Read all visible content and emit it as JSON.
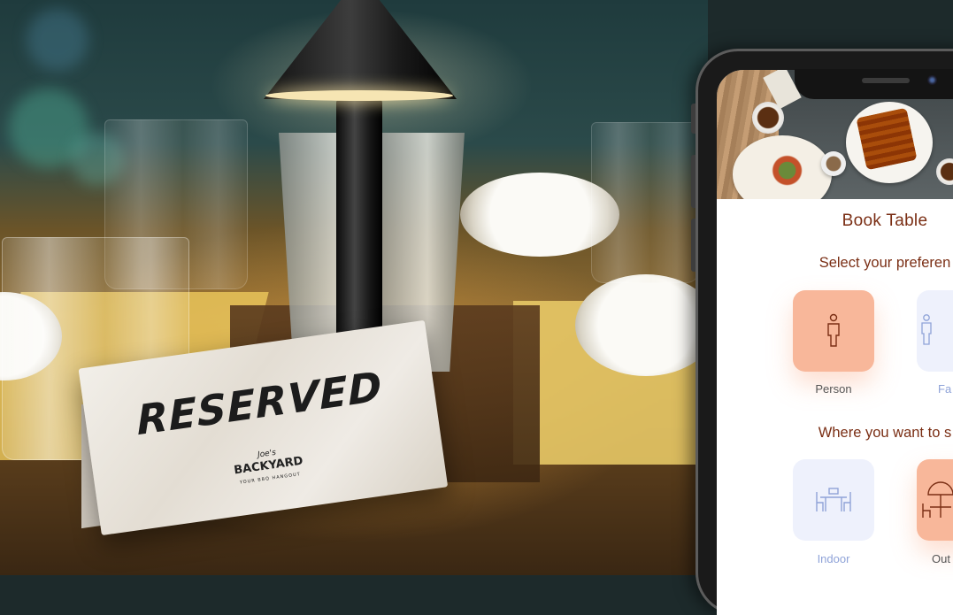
{
  "sign": {
    "title": "RESERVED",
    "brand_line1": "Joe's",
    "brand_line2": "BACKYARD",
    "brand_tagline": "YOUR BBQ HANGOUT"
  },
  "app": {
    "title": "Book Table",
    "preference_heading": "Select your preferen",
    "preference_options": [
      {
        "label": "Person",
        "icon": "person-icon",
        "state": "selected"
      },
      {
        "label": "Fa",
        "icon": "family-icon",
        "state": "unselected"
      }
    ],
    "seating_heading": "Where you want to s",
    "seating_options": [
      {
        "label": "Indoor",
        "icon": "indoor-table-icon",
        "state": "unselected"
      },
      {
        "label": "Out",
        "icon": "outdoor-table-icon",
        "state": "selected"
      }
    ]
  },
  "colors": {
    "accent_text": "#7a2e14",
    "selected_tile": "#f8b79a",
    "unselected_tile": "#eef1fc",
    "unselected_label": "#8fa3d8"
  }
}
